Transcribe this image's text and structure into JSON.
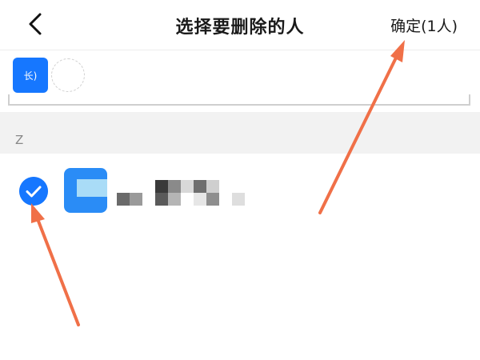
{
  "header": {
    "back_icon": "chevron-left-icon",
    "title": "选择要删除的人",
    "confirm_label": "确定(1人)"
  },
  "selected": {
    "chip_label": "长)"
  },
  "section": {
    "letter": "Z"
  },
  "contact": {
    "checked": true,
    "check_icon": "checkmark-icon",
    "avatar_icon": "group-avatar-icon"
  },
  "annotations": {
    "arrow_color": "#f07048",
    "accent_color": "#1677ff"
  }
}
